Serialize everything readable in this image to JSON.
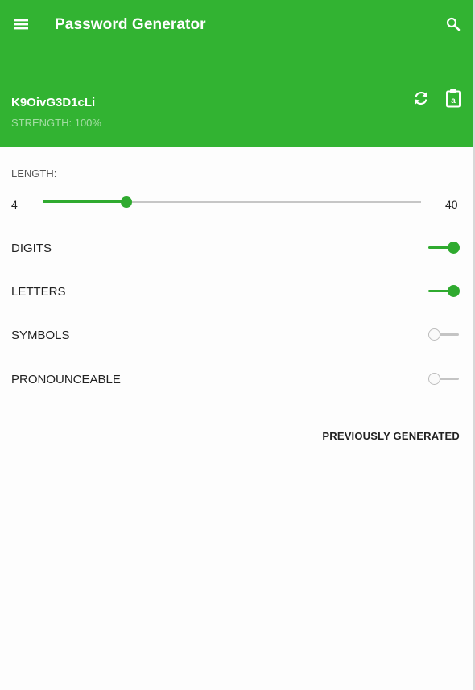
{
  "app": {
    "title": "Password Generator",
    "accent_color": "#32b332"
  },
  "header": {
    "menu_icon": "hamburger-menu-icon",
    "search_icon": "search-icon",
    "password": "K9OivG3D1cLi",
    "strength": "STRENGTH: 100%",
    "refresh_icon": "refresh-icon",
    "copy_icon": "clipboard-icon"
  },
  "length": {
    "label": "LENGTH:",
    "min": "4",
    "max": "40",
    "value": 12
  },
  "options": [
    {
      "label": "DIGITS",
      "enabled": true
    },
    {
      "label": "LETTERS",
      "enabled": true
    },
    {
      "label": "SYMBOLS",
      "enabled": false
    },
    {
      "label": "PRONOUNCEABLE",
      "enabled": false
    }
  ],
  "previous_button": "PREVIOUSLY GENERATED"
}
